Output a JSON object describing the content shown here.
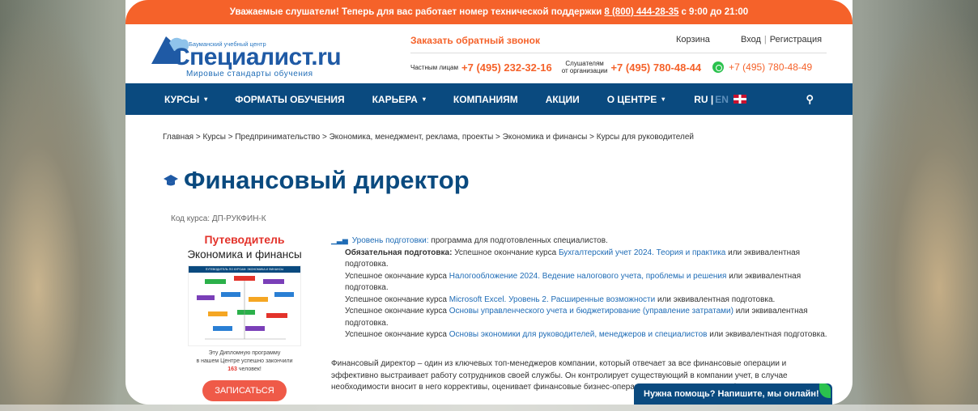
{
  "topbar": {
    "text_before": "Уважаемые слушатели! Теперь для вас работает номер технической поддержки",
    "phone": "8 (800) 444-28-35",
    "text_after": "с 9:00 до 21:00"
  },
  "logo": {
    "small_text": "Бауманский учебный центр",
    "name": "Специалист.ru",
    "slogan": "Мировые стандарты обучения"
  },
  "header": {
    "callback": "Заказать обратный звонок",
    "cart": "Корзина",
    "login": "Вход",
    "register": "Регистрация",
    "private_label": "Частным лицам",
    "private_phone": "+7 (495) 232-32-16",
    "org_label_1": "Слушателям",
    "org_label_2": "от организации",
    "org_phone": "+7 (495) 780-48-44",
    "whatsapp_phone": "+7 (495) 780-48-49"
  },
  "nav": {
    "items": [
      {
        "label": "КУРСЫ",
        "caret": "▾"
      },
      {
        "label": "ФОРМАТЫ ОБУЧЕНИЯ",
        "caret": ""
      },
      {
        "label": "КАРЬЕРА",
        "caret": "▾"
      },
      {
        "label": "КОМПАНИЯМ",
        "caret": ""
      },
      {
        "label": "АКЦИИ",
        "caret": ""
      },
      {
        "label": "О ЦЕНТРЕ",
        "caret": "▾"
      }
    ],
    "lang_ru": "RU |",
    "lang_en": "EN",
    "search_icon": "⚲"
  },
  "breadcrumbs": "Главная > Курсы > Предпринимательство > Экономика, менеджмент, реклама, проекты > Экономика и финансы > Курсы для руководителей",
  "title": "Финансовый директор",
  "course_code": "Код курса: ДП-РУКФИН-К",
  "guide": {
    "title": "Путеводитель",
    "subtitle": "Экономика и финансы",
    "image_title": "ПУТЕВОДИТЕЛЬ ПО КУРСАМ: ЭКОНОМИКА И ФИНАНСЫ",
    "grad_1": "Эту Дипломную программу",
    "grad_2": "в нашем Центре успешно закончили",
    "grad_count": "163",
    "grad_3": "человек!",
    "enroll": "ЗАПИСАТЬСЯ"
  },
  "requirements": {
    "level_label": "Уровень подготовки:",
    "level_text": "программа для подготовленных специалистов.",
    "mandatory_label": "Обязательная подготовка:",
    "prefix_first": "Успешное окончание курса",
    "prefix": "Успешное окончание курса",
    "courses": [
      {
        "name": "Бухгалтерский учет 2024. Теория и практика",
        "suffix": "или эквивалентная подготовка."
      },
      {
        "name": "Налогообложение 2024. Ведение налогового учета, проблемы и решения",
        "suffix": "или эквивалентная подготовка."
      },
      {
        "name": "Microsoft Excel. Уровень 2. Расширенные возможности",
        "suffix": "или эквивалентная подготовка."
      },
      {
        "name": "Основы управленческого учета и бюджетирование (управление затратами)",
        "suffix": "или эквивалентная подготовка."
      },
      {
        "name": "Основы экономики для руководителей, менеджеров и специалистов",
        "suffix": "или эквивалентная подготовка."
      }
    ]
  },
  "description": "Финансовый директор – один из ключевых топ-менеджеров компании, который отвечает за все финансовые операции и эффективно выстраивает работу сотрудников своей службы. Он контролирует существующий в компании учет, в случае необходимости вносит в него коррективы, оценивает финансовые бизнес-операции описывает языком цифр.",
  "chat": "Нужна помощь? Напишите, мы онлайн!",
  "colors": {
    "accent": "#f5622a",
    "nav": "#0a4a7f",
    "link": "#1f6cb6",
    "red": "#e3332b"
  }
}
